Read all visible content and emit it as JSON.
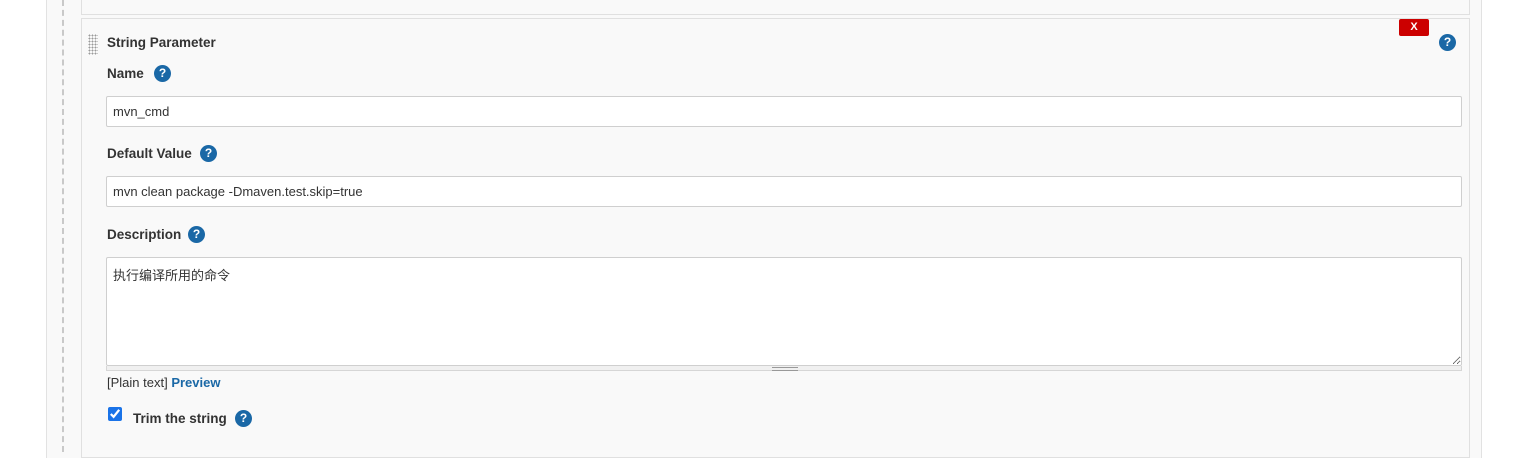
{
  "parameter": {
    "title": "String Parameter",
    "delete_label": "X",
    "help_glyph": "?",
    "name": {
      "label": "Name",
      "value": "mvn_cmd"
    },
    "default_value": {
      "label": "Default Value",
      "value": "mvn clean package -Dmaven.test.skip=true"
    },
    "description": {
      "label": "Description",
      "value": "执行编译所用的命令",
      "format_prefix": "[Plain text]",
      "preview_label": "Preview"
    },
    "trim": {
      "label": "Trim the string",
      "checked": true
    }
  },
  "colors": {
    "delete_button": "#cc0000",
    "help_icon": "#1a68a6",
    "link": "#1a68a6",
    "panel_bg": "#f9f9f9"
  },
  "icons": {
    "help": "question-circle-icon",
    "drag": "drag-handle-icon"
  }
}
